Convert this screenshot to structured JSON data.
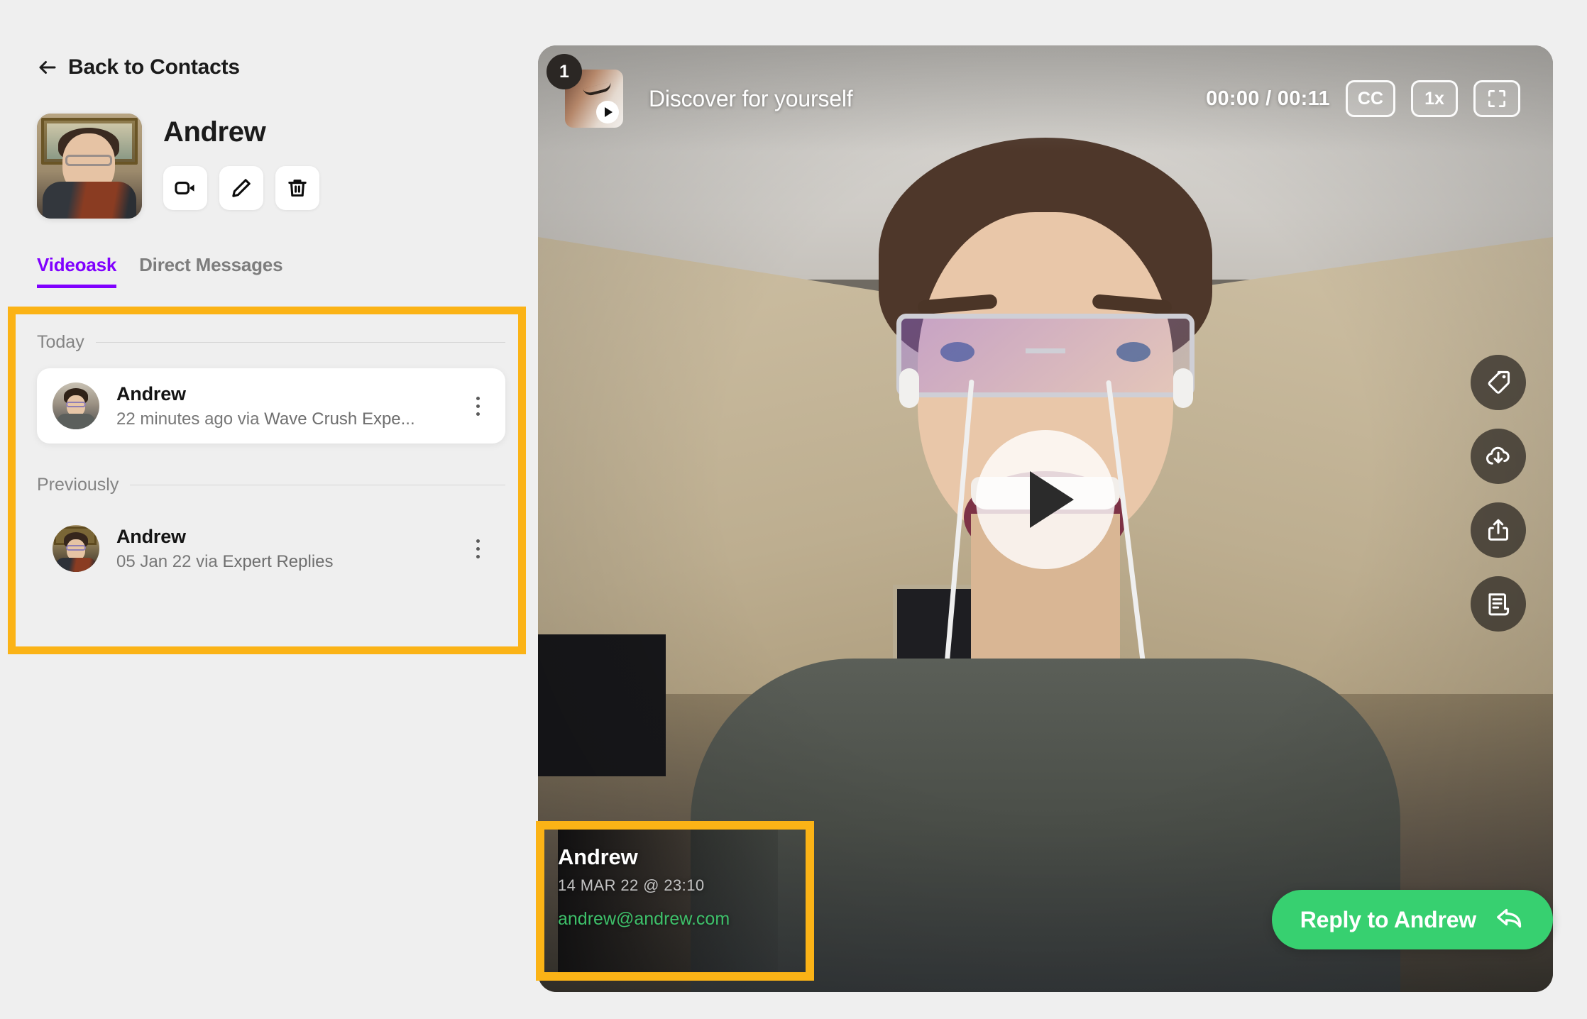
{
  "left": {
    "back_label": "Back to Contacts",
    "contact_name": "Andrew",
    "actions": [
      {
        "name": "video-call-button",
        "icon": "video-camera-icon"
      },
      {
        "name": "edit-contact-button",
        "icon": "pencil-icon"
      },
      {
        "name": "delete-contact-button",
        "icon": "trash-icon"
      }
    ],
    "tabs": [
      {
        "label": "Videoask",
        "active": true
      },
      {
        "label": "Direct Messages",
        "active": false
      }
    ],
    "sections": [
      {
        "label": "Today",
        "items": [
          {
            "name": "Andrew",
            "time": "22 minutes ago via ",
            "via": "Wave Crush Expe...",
            "selected": true
          }
        ]
      },
      {
        "label": "Previously",
        "items": [
          {
            "name": "Andrew",
            "time": "05 Jan 22 via ",
            "via": "Expert Replies",
            "selected": false
          }
        ]
      }
    ]
  },
  "player": {
    "step_number": "1",
    "title": "Discover for yourself",
    "time_display": "00:00 / 00:11",
    "cc_label": "CC",
    "speed_label": "1x",
    "fullscreen_icon": "fullscreen-icon",
    "play_icon": "play-icon",
    "rail": [
      {
        "name": "tag-icon",
        "label": "Tag"
      },
      {
        "name": "cloud-download-icon",
        "label": "Download"
      },
      {
        "name": "share-icon",
        "label": "Share"
      },
      {
        "name": "transcript-icon",
        "label": "Transcript"
      }
    ],
    "respondent": {
      "name": "Andrew",
      "date": "14 MAR 22 @ 23:10",
      "email": "andrew@andrew.com"
    },
    "reply_label": "Reply to Andrew",
    "reply_icon": "reply-arrow-icon"
  },
  "colors": {
    "accent_purple": "#8000ff",
    "highlight_yellow": "#fbb316",
    "reply_green": "#37d070",
    "email_green": "#3ec06a",
    "page_bg": "#efefef"
  }
}
